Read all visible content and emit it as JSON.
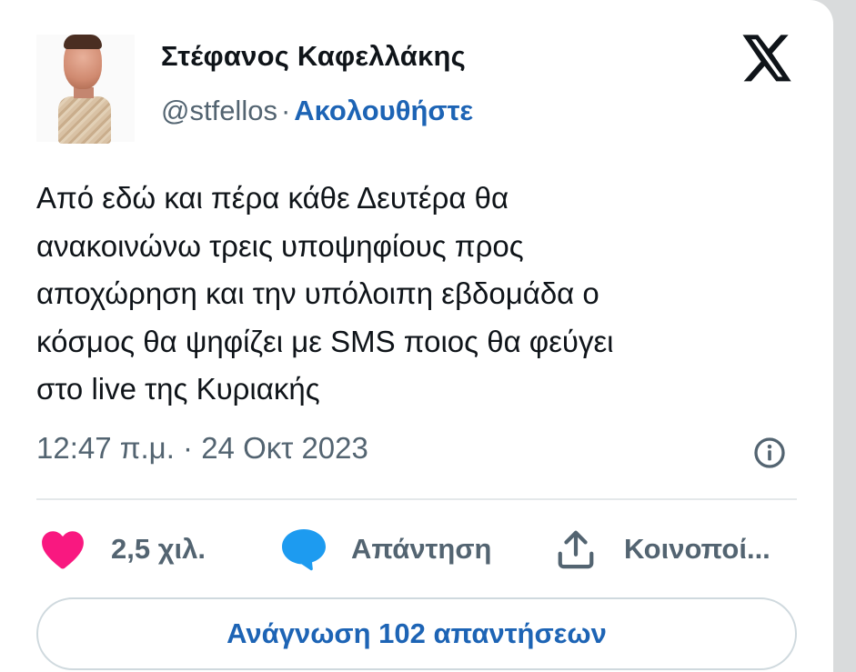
{
  "author": {
    "name": "Στέφανος Καφελλάκης",
    "handle": "@stfellos",
    "separator": "·",
    "follow_label": "Ακολουθήστε"
  },
  "icons": {
    "brand": "x-logo-icon",
    "info": "info-icon",
    "like": "heart-icon",
    "reply": "speech-bubble-icon",
    "share": "share-icon"
  },
  "tweet": {
    "lines": [
      "Από εδώ και πέρα κάθε Δευτέρα θα",
      "ανακοινώνω τρεις υποψηφίους προς",
      "αποχώρηση και την υπόλοιπη εβδομάδα ο",
      "κόσμος θα ψηφίζει με SMS ποιος θα φεύγει",
      "στο live της Κυριακής"
    ],
    "timestamp": "12:47 π.μ. · 24 Οκτ 2023"
  },
  "actions": {
    "likes": "2,5 χιλ.",
    "reply": "Απάντηση",
    "share": "Κοινοποί..."
  },
  "read_replies_label": "Ανάγνωση 102 απαντήσεων",
  "colors": {
    "like": "#f91880",
    "reply": "#1d9bf0",
    "link": "#1d64b5",
    "muted": "#536471",
    "text": "#0f1419"
  }
}
